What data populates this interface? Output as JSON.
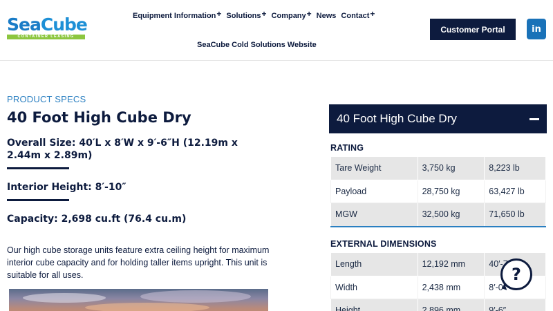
{
  "brand": {
    "logo_sea": "Sea",
    "logo_cube": "Cube",
    "logo_tagline": "CONTAINER LEASING"
  },
  "nav": {
    "items": [
      {
        "label": "Equipment Information",
        "has_plus": true
      },
      {
        "label": "Solutions",
        "has_plus": true
      },
      {
        "label": "Company",
        "has_plus": true
      },
      {
        "label": "News",
        "has_plus": false
      },
      {
        "label": "Contact",
        "has_plus": true
      }
    ],
    "plus_glyph": "+",
    "secondary_link": "SeaCube Cold Solutions Website",
    "portal_button": "Customer Portal",
    "linkedin_label": "in"
  },
  "product": {
    "eyebrow": "PRODUCT SPECS",
    "title": "40 Foot High Cube Dry",
    "overall_size": "Overall Size: 40′L x 8′W x 9′-6″H (12.19m x 2.44m x 2.89m)",
    "interior_height": "Interior Height: 8′-10″",
    "capacity": "Capacity: 2,698 cu.ft (76.4 cu.m)",
    "description": "Our high cube storage units feature extra ceiling height for maximum interior cube capacity and for holding taller items upright. This unit is suitable for all uses."
  },
  "panel": {
    "title": "40 Foot High Cube Dry",
    "collapse_icon": "minus-icon",
    "sections": [
      {
        "label": "RATING",
        "rows": [
          [
            "Tare Weight",
            "3,750 kg",
            "8,223 lb"
          ],
          [
            "Payload",
            "28,750 kg",
            "63,427 lb"
          ],
          [
            "MGW",
            "32,500 kg",
            "71,650 lb"
          ]
        ]
      },
      {
        "label": "EXTERNAL DIMENSIONS",
        "rows": [
          [
            "Length",
            "12,192 mm",
            "40′-7"
          ],
          [
            "Width",
            "2,438 mm",
            "8′-0"
          ],
          [
            "Height",
            "2,896 mm",
            "9′-6″"
          ]
        ]
      }
    ]
  },
  "help": {
    "glyph": "?"
  },
  "colors": {
    "navy": "#0d1b3e",
    "accent_blue": "#2a7fc1",
    "logo_green": "#8cc63f",
    "row_gray": "#e6e6e6"
  }
}
